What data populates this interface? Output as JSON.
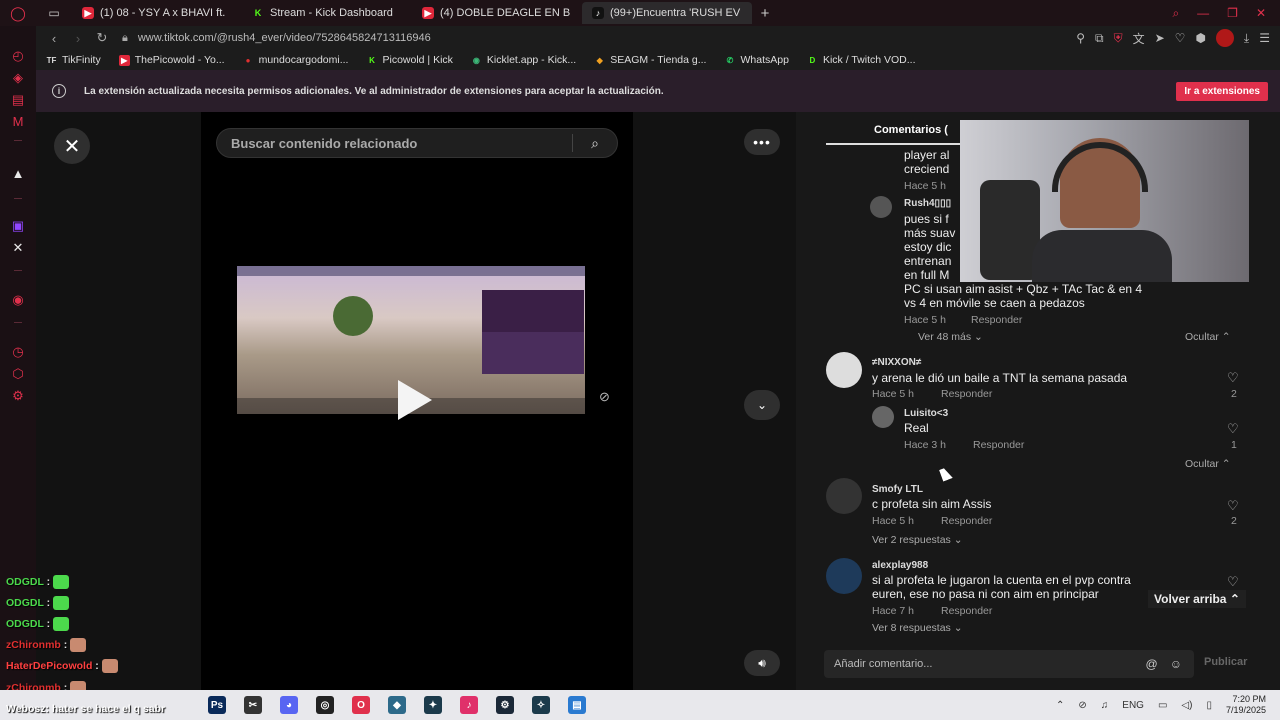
{
  "browser": {
    "tabs": [
      {
        "label": "(1) 08 - YSY A x BHAVI ft.",
        "icon": "youtube-icon",
        "active": false
      },
      {
        "label": "Stream - Kick Dashboard",
        "icon": "kick-icon",
        "active": false
      },
      {
        "label": "(4) DOBLE DEAGLE EN B",
        "icon": "youtube-icon",
        "active": false
      },
      {
        "label": "(99+)Encuentra 'RUSH EV",
        "icon": "tiktok-icon",
        "active": true
      }
    ],
    "new_tab": "+",
    "url": "www.tiktok.com/@rush4_ever/video/7528645824713116946",
    "bookmarks": [
      {
        "label": "TikFinity",
        "icon": "TF"
      },
      {
        "label": "ThePicowold - Yo...",
        "icon": "▶"
      },
      {
        "label": "mundocargodomi...",
        "icon": "●"
      },
      {
        "label": "Picowold | Kick",
        "icon": "K"
      },
      {
        "label": "Kicklet.app - Kick...",
        "icon": "◉"
      },
      {
        "label": "SEAGM - Tienda g...",
        "icon": "◆"
      },
      {
        "label": "WhatsApp",
        "icon": "✆"
      },
      {
        "label": "Kick / Twitch VOD...",
        "icon": "D"
      }
    ]
  },
  "banner": {
    "text": "La extensión actualizada necesita permisos adicionales. Ve al administrador de extensiones para aceptar la actualización.",
    "button": "Ir a extensiones"
  },
  "tiktok": {
    "search_placeholder": "Buscar contenido relacionado",
    "comments_tab": "Comentarios (",
    "comments": {
      "c0_line1": "player al",
      "c0_line2": "creciend",
      "c0_time": "Hace 5 h",
      "r1_user": "Rush4▯▯▯",
      "r1_lines": [
        "pues si f",
        "más suav",
        "estoy dic",
        "entrenan",
        "en full M"
      ],
      "r1_line6": "PC si usan aim asist + Qbz + TAc Tac & en 4",
      "r1_line7": "vs 4 en móvile se caen a pedazos",
      "r1_time": "Hace 5 h",
      "reply": "Responder",
      "view_more_1": "Ver 48 más",
      "hide": "Ocultar",
      "c2_user": "≠NIXXON≠",
      "c2_text": "y arena le dió un baile a TNT la semana pasada",
      "c2_time": "Hace 5 h",
      "c2_likes": "2",
      "r2_user": "Luisito<3",
      "r2_text": "Real",
      "r2_time": "Hace 3 h",
      "r2_likes": "1",
      "c3_user": "Smofy LTL",
      "c3_text": "c profeta sin aim Assis",
      "c3_time": "Hace 5 h",
      "c3_likes": "2",
      "c3_replies": "Ver 2 respuestas",
      "c4_user": "alexplay988",
      "c4_line1": "si al profeta le jugaron la cuenta en el pvp contra",
      "c4_line2": "euren, ese no pasa ni con aim en principar",
      "c4_time": "Hace 7 h",
      "c4_replies": "Ver 8 respuestas"
    },
    "back_to_top": "Volver arriba",
    "add_comment_placeholder": "Añadir comentario...",
    "publish": "Publicar"
  },
  "stream_chat": [
    {
      "user": "ODGDL",
      "text": ":",
      "color": "#4cd94c"
    },
    {
      "user": "ODGDL",
      "text": ":",
      "color": "#4cd94c"
    },
    {
      "user": "ODGDL",
      "text": ":",
      "color": "#4cd94c"
    },
    {
      "user": "zChironmb",
      "text": ":",
      "color": "#e03030"
    },
    {
      "user": "HaterDePicowold",
      "text": ":",
      "color": "#ff4040"
    },
    {
      "user": "zChironmb",
      "text": ":",
      "color": "#e03030"
    },
    {
      "user": "Webosz",
      "text": ": hater se hace el q sabr",
      "color": "#ffffff"
    }
  ],
  "taskbar": {
    "lang": "ENG",
    "time": "7:20 PM",
    "date": "7/19/2025"
  },
  "colors": {
    "accent": "#e0304c",
    "background": "#121212"
  }
}
